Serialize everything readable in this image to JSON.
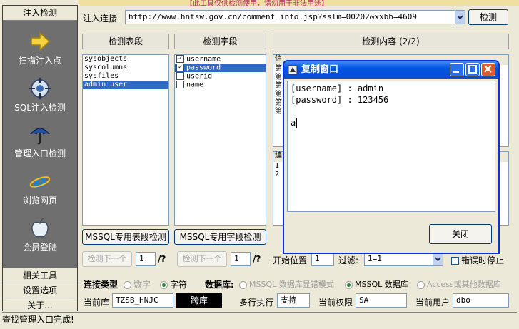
{
  "top_banner": "【此工具仅供检测使用，请勿用于非法用途】",
  "sidebar": {
    "header": "注入检测",
    "items": [
      {
        "label": "扫描注入点",
        "icon": "arrow-right-icon"
      },
      {
        "label": "SQL注入检测",
        "icon": "crosshair-icon"
      },
      {
        "label": "管理入口检测",
        "icon": "umbrella-icon"
      },
      {
        "label": "浏览网页",
        "icon": "ie-browser-icon"
      },
      {
        "label": "会员登陆",
        "icon": "apple-icon"
      }
    ],
    "bottom": [
      "相关工具",
      "设置选项",
      "关于..."
    ]
  },
  "status_text": "查找管理入口完成!",
  "url_bar": {
    "label": "注入连接",
    "value": "http://www.hntsw.gov.cn/comment_info.jsp?sslm=00202&xxbh=4609",
    "button": "检测"
  },
  "tables_panel": {
    "header": "检测表段",
    "items": [
      "sysobjects",
      "syscolumns",
      "sysfiles",
      "admin_user"
    ],
    "selected": 3,
    "button": "MSSQL专用表段检测"
  },
  "fields_panel": {
    "header": "检测字段",
    "items": [
      {
        "name": "username",
        "checked": true
      },
      {
        "name": "password",
        "checked": true
      },
      {
        "name": "userid",
        "checked": false
      },
      {
        "name": "name",
        "checked": false
      }
    ],
    "selected": 1,
    "button": "MSSQL专用字段检测"
  },
  "content_panel": {
    "header": "检测内容 (2/2)",
    "partial_header": "信",
    "partial_rows": [
      "第",
      "第",
      "第",
      "第",
      "第",
      "第"
    ],
    "partial_header2": "编",
    "partial_rows2": [
      "1",
      "2"
    ]
  },
  "nav_row": {
    "next_table": "检测下一个",
    "table_num": "1",
    "table_suffix": "/?",
    "next_field": "检测下一个",
    "field_num": "1",
    "field_suffix": "/?",
    "start_label": "开始位置",
    "start_value": "1",
    "filter_label": "过滤:",
    "filter_value": "1=1",
    "stop_on_error": "错误时停止"
  },
  "conn_type": {
    "label": "连接类型",
    "options": [
      "数字",
      "字符"
    ],
    "selected": 1
  },
  "database": {
    "label": "数据库:",
    "options": [
      "MSSQL 数据库显错模式",
      "MSSQL 数据库",
      "Access或其他数据库"
    ],
    "selected": 1
  },
  "bottom_row": {
    "current_db_label": "当前库",
    "current_db": "TZSB_HNJC",
    "cross_db": "跨库",
    "multi_exec_label": "多行执行",
    "multi_exec": "支持",
    "privilege_label": "当前权限",
    "privilege": "SA",
    "user_label": "当前用户",
    "user": "dbo"
  },
  "dialog": {
    "title": "复制窗口",
    "lines": [
      "[username] : admin",
      "[password] : 123456",
      "",
      "a"
    ],
    "close_button": "关闭"
  }
}
